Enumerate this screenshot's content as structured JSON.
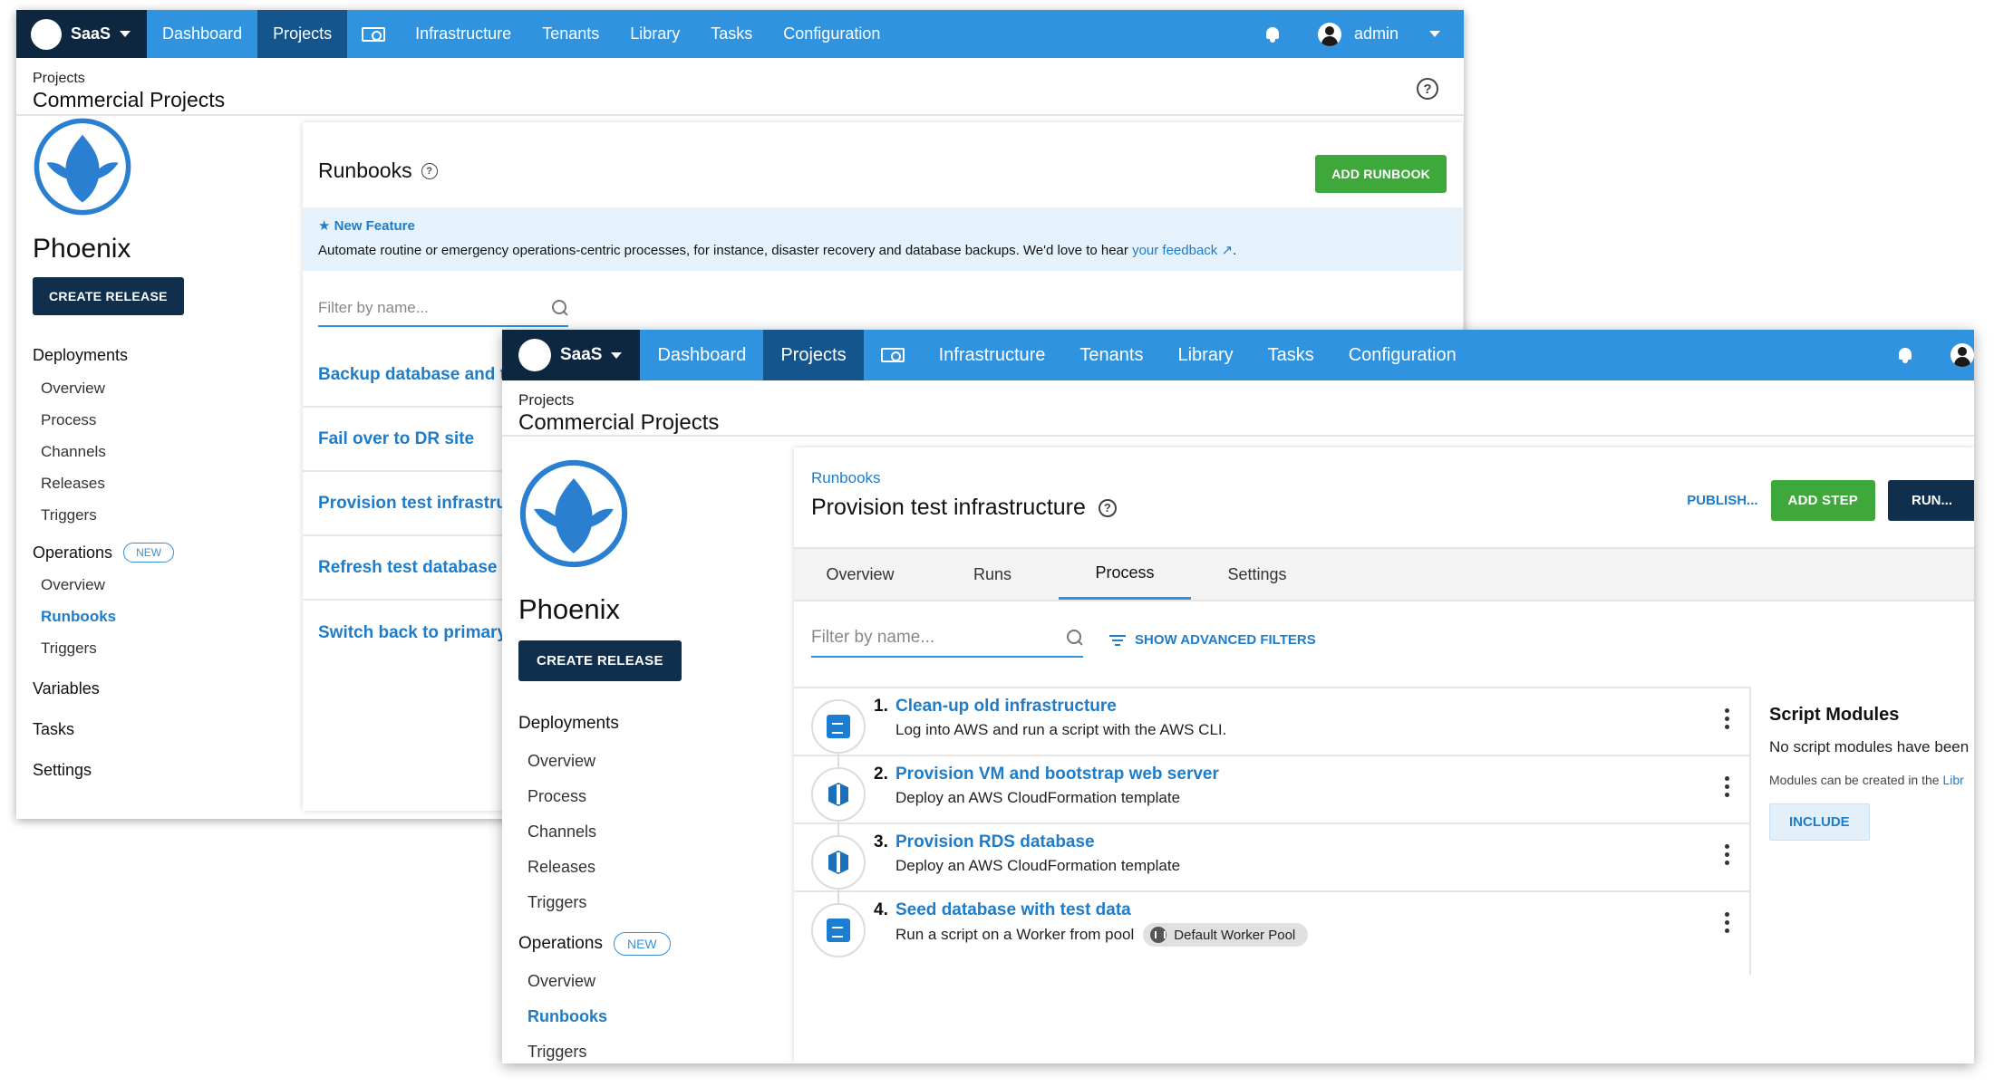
{
  "nav": {
    "brand": "SaaS",
    "items": [
      "Dashboard",
      "Projects",
      "Infrastructure",
      "Tenants",
      "Library",
      "Tasks",
      "Configuration"
    ],
    "active": "Projects",
    "user": "admin"
  },
  "breadcrumb": {
    "parent": "Projects",
    "title": "Commercial Projects"
  },
  "project": {
    "name": "Phoenix",
    "create_release": "CREATE RELEASE",
    "deployments": {
      "label": "Deployments",
      "items": [
        "Overview",
        "Process",
        "Channels",
        "Releases",
        "Triggers"
      ]
    },
    "operations": {
      "label": "Operations",
      "badge": "NEW",
      "items": [
        "Overview",
        "Runbooks",
        "Triggers"
      ],
      "active": "Runbooks"
    },
    "other": [
      "Variables",
      "Tasks",
      "Settings"
    ]
  },
  "runbooks_page": {
    "title": "Runbooks",
    "add_button": "ADD RUNBOOK",
    "banner": {
      "title": "New Feature",
      "text": "Automate routine or emergency operations-centric processes, for instance, disaster recovery and database backups. We'd love to hear",
      "link": "your feedback",
      "end": "."
    },
    "filter_placeholder": "Filter by name...",
    "items": [
      "Backup database and tes",
      "Fail over to DR site",
      "Provision test infrastructu",
      "Refresh test database wit",
      "Switch back to primary pr"
    ]
  },
  "runbook_detail": {
    "crumb": "Runbooks",
    "title": "Provision test infrastructure",
    "publish": "PUBLISH...",
    "add_step": "ADD STEP",
    "run": "RUN...",
    "tabs": [
      "Overview",
      "Runs",
      "Process",
      "Settings"
    ],
    "active_tab": "Process",
    "filter_placeholder": "Filter by name...",
    "advanced_filters": "SHOW ADVANCED FILTERS",
    "steps": [
      {
        "num": "1.",
        "name": "Clean-up old infrastructure",
        "desc": "Log into AWS and run a script with the AWS CLI.",
        "icon": "script-icon"
      },
      {
        "num": "2.",
        "name": "Provision VM and bootstrap web server",
        "desc": "Deploy an AWS CloudFormation template",
        "icon": "cloudformation-icon"
      },
      {
        "num": "3.",
        "name": "Provision RDS database",
        "desc": "Deploy an AWS CloudFormation template",
        "icon": "cloudformation-icon"
      },
      {
        "num": "4.",
        "name": "Seed database with test data",
        "desc": "Run a script on a Worker from pool",
        "pool": "Default Worker Pool",
        "icon": "script-icon"
      }
    ],
    "modules": {
      "title": "Script Modules",
      "empty": "No script modules have been",
      "hint": "Modules can be created in the",
      "hint_link": "Libr",
      "include": "INCLUDE"
    }
  },
  "colors": {
    "topbar": "#2f93e0",
    "brand_bg": "#0d2740",
    "active_nav": "#15558e",
    "link": "#1f7cc8",
    "green": "#3fa83b",
    "dark_button": "#0f2f4d"
  }
}
